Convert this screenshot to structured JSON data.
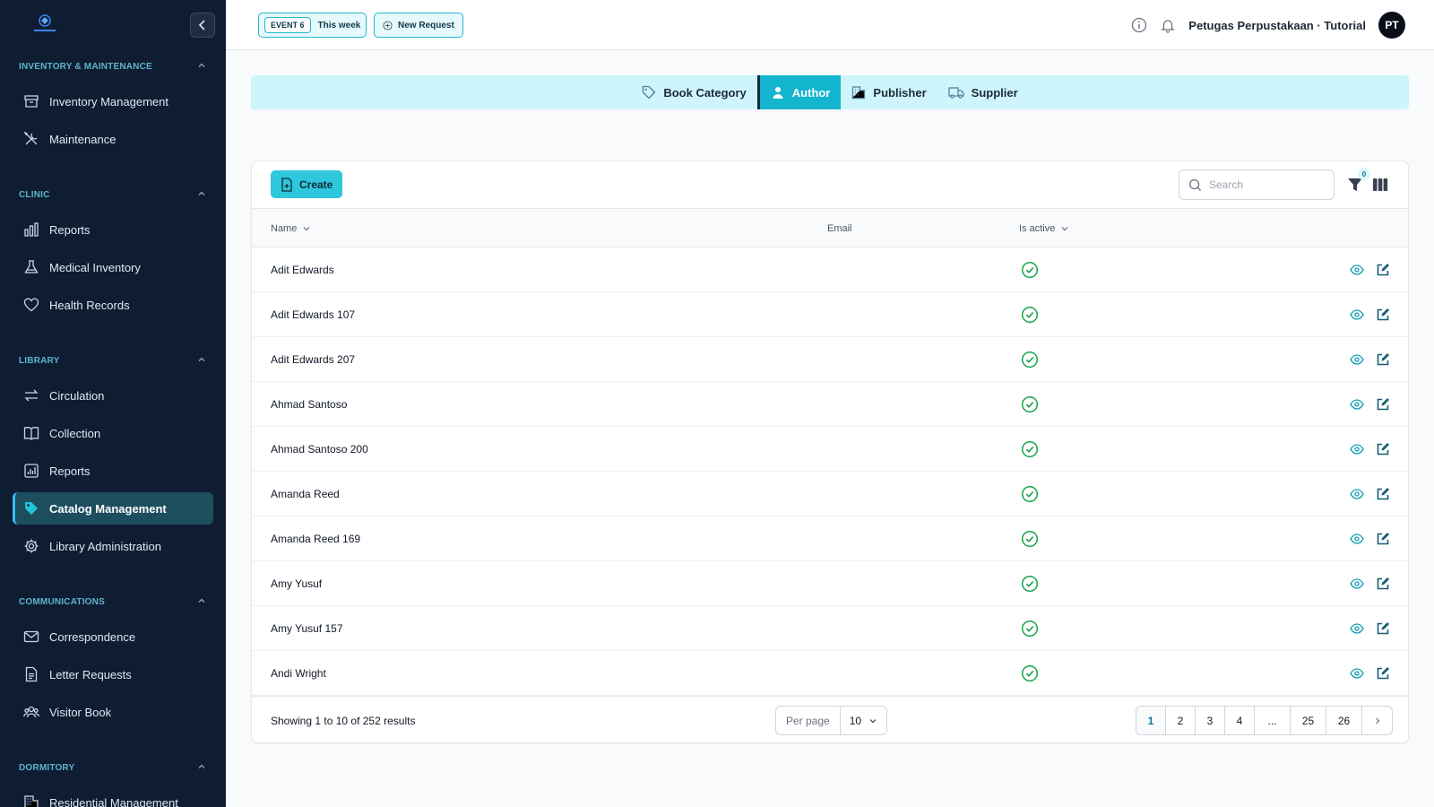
{
  "colors": {
    "sidebar_bg": "#0f1d33",
    "accent": "#13b5cf",
    "active_item_bg": "#1c4e5e",
    "success": "#16a34a"
  },
  "sidebar": {
    "sections": [
      {
        "title": "INVENTORY & MAINTENANCE",
        "items": [
          {
            "label": "Inventory Management",
            "icon": "archive-icon"
          },
          {
            "label": "Maintenance",
            "icon": "tools-icon"
          }
        ]
      },
      {
        "title": "CLINIC",
        "items": [
          {
            "label": "Reports",
            "icon": "chart-bar-icon"
          },
          {
            "label": "Medical Inventory",
            "icon": "flask-icon"
          },
          {
            "label": "Health Records",
            "icon": "heart-icon"
          }
        ]
      },
      {
        "title": "LIBRARY",
        "items": [
          {
            "label": "Circulation",
            "icon": "arrows-exchange-icon"
          },
          {
            "label": "Collection",
            "icon": "book-open-icon"
          },
          {
            "label": "Reports",
            "icon": "report-chart-icon"
          },
          {
            "label": "Catalog Management",
            "icon": "tag-icon",
            "active": true
          },
          {
            "label": "Library Administration",
            "icon": "gear-icon"
          }
        ]
      },
      {
        "title": "COMMUNICATIONS",
        "items": [
          {
            "label": "Correspondence",
            "icon": "envelope-icon"
          },
          {
            "label": "Letter Requests",
            "icon": "document-icon"
          },
          {
            "label": "Visitor Book",
            "icon": "users-icon"
          }
        ]
      },
      {
        "title": "DORMITORY",
        "items": [
          {
            "label": "Residential Management",
            "icon": "building-icon"
          }
        ]
      }
    ]
  },
  "topbar": {
    "event_tag": "EVENT 6",
    "event_period": "This week",
    "new_request": "New Request",
    "user_name": "Petugas Perpustakaan · Tutorial",
    "avatar_initials": "PT"
  },
  "tabs": [
    {
      "label": "Book Category",
      "icon": "tag-icon",
      "active": false
    },
    {
      "label": "Author",
      "icon": "user-icon",
      "active": true
    },
    {
      "label": "Publisher",
      "icon": "building-icon",
      "active": false
    },
    {
      "label": "Supplier",
      "icon": "truck-icon",
      "active": false
    }
  ],
  "table": {
    "create_label": "Create",
    "search_placeholder": "Search",
    "filter_count": "0",
    "columns": {
      "name": "Name",
      "email": "Email",
      "is_active": "Is active"
    },
    "rows": [
      {
        "name": "Adit Edwards",
        "email": "",
        "is_active": true
      },
      {
        "name": "Adit Edwards 107",
        "email": "",
        "is_active": true
      },
      {
        "name": "Adit Edwards 207",
        "email": "",
        "is_active": true
      },
      {
        "name": "Ahmad Santoso",
        "email": "",
        "is_active": true
      },
      {
        "name": "Ahmad Santoso 200",
        "email": "",
        "is_active": true
      },
      {
        "name": "Amanda Reed",
        "email": "",
        "is_active": true
      },
      {
        "name": "Amanda Reed 169",
        "email": "",
        "is_active": true
      },
      {
        "name": "Amy Yusuf",
        "email": "",
        "is_active": true
      },
      {
        "name": "Amy Yusuf 157",
        "email": "",
        "is_active": true
      },
      {
        "name": "Andi Wright",
        "email": "",
        "is_active": true
      }
    ],
    "footer": {
      "showing": "Showing 1 to 10 of 252 results",
      "per_page_label": "Per page",
      "per_page_value": "10",
      "pages": [
        "1",
        "2",
        "3",
        "4",
        "...",
        "25",
        "26"
      ],
      "current_page": "1"
    }
  }
}
